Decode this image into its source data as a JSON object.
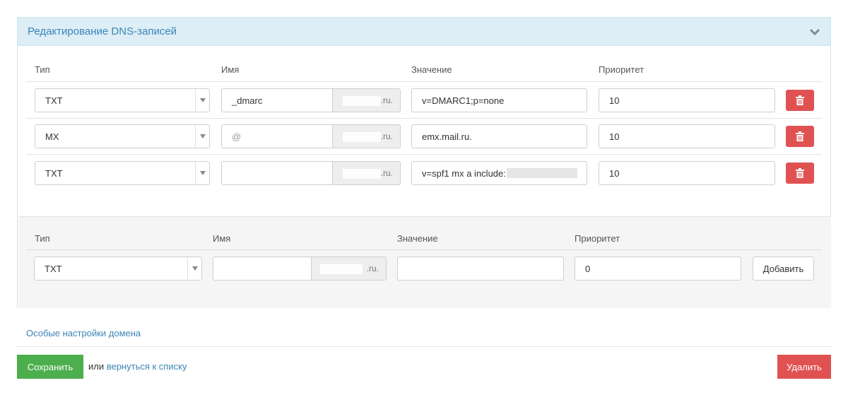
{
  "panel": {
    "title": "Редактирование DNS-записей",
    "collapse_icon": "chevron-down-icon"
  },
  "columns": {
    "type": "Тип",
    "name": "Имя",
    "value": "Значение",
    "priority": "Приоритет"
  },
  "records": [
    {
      "type": "TXT",
      "name": "_dmarc",
      "name_is_placeholder": false,
      "suffix": ".ru.",
      "value": "v=DMARC1;p=none",
      "priority": "10"
    },
    {
      "type": "MX",
      "name": "@",
      "name_is_placeholder": true,
      "suffix": ".ru.",
      "value": "emx.mail.ru.",
      "priority": "10"
    },
    {
      "type": "TXT",
      "name": "",
      "name_is_placeholder": false,
      "suffix": ".ru.",
      "value": "v=spf1 mx a include:",
      "priority": "10"
    }
  ],
  "new_record": {
    "type": "TXT",
    "name": "",
    "suffix": ".ru.",
    "value": "",
    "priority": "0",
    "add_label": "Добавить"
  },
  "footer": {
    "domain_settings_link": "Особые настройки домена",
    "save_label": "Сохранить",
    "or_text": "или",
    "back_link": "вернуться к списку",
    "delete_label": "Удалить"
  },
  "colors": {
    "accent": "#3b84b6",
    "header_bg": "#ddeef7",
    "danger": "#e05252",
    "success": "#4cae4c"
  }
}
